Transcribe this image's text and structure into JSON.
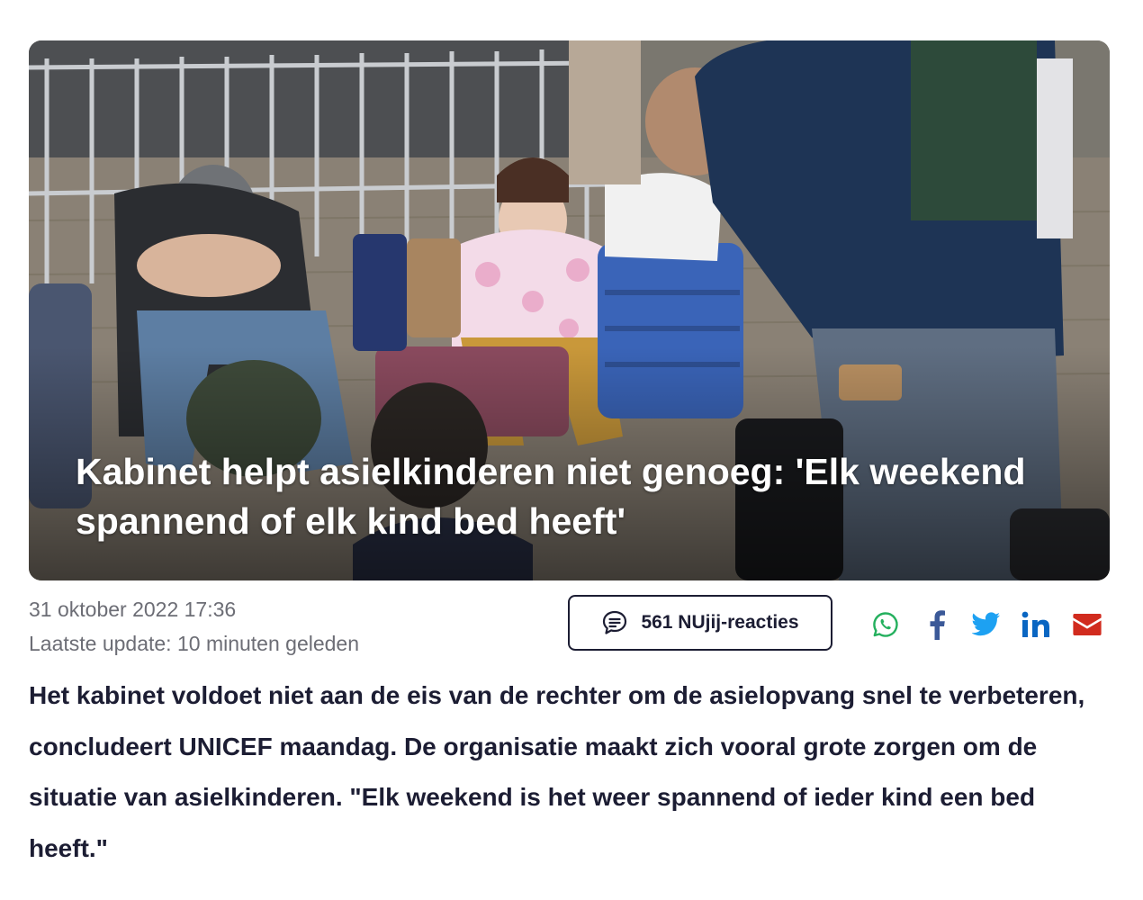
{
  "article": {
    "title": "Kabinet helpt asielkinderen niet genoeg: 'Elk weekend spannend of elk kind bed heeft'",
    "date": "31 oktober 2022 17:36",
    "last_update": "Laatste update: 10 minuten geleden",
    "intro": "Het kabinet voldoet niet aan de eis van de rechter om de asielopvang snel te verbeteren, concludeert UNICEF maandag. De organisatie maakt zich vooral grote zorgen om de situatie van asielkinderen. \"Elk weekend is het weer spannend of ieder kind een bed heeft.\""
  },
  "comments": {
    "label": "561 NUjij-reacties",
    "icon": "comment-bubble-icon"
  },
  "share": [
    {
      "name": "whatsapp",
      "icon": "whatsapp-icon",
      "color": "#25b05e"
    },
    {
      "name": "facebook",
      "icon": "facebook-icon",
      "color": "#3b5998"
    },
    {
      "name": "twitter",
      "icon": "twitter-icon",
      "color": "#1da1f2"
    },
    {
      "name": "linkedin",
      "icon": "linkedin-icon",
      "color": "#0a66c2"
    },
    {
      "name": "mail",
      "icon": "mail-icon",
      "color": "#d12b1e"
    }
  ],
  "colors": {
    "text": "#1c1d33",
    "meta_text": "#6c6d75",
    "title_overlay": "#ffffff"
  }
}
